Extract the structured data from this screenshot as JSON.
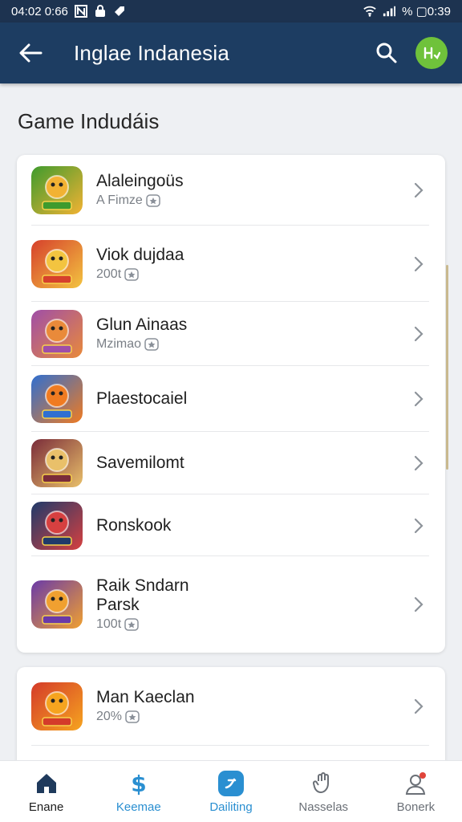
{
  "status_bar": {
    "time": "04:02 0:66",
    "battery_text": "% ▢0:39"
  },
  "app_bar": {
    "title": "Inglae Indanesia"
  },
  "section": {
    "title": "Game Indudáis"
  },
  "apps": [
    {
      "name": "Alaleingoüs",
      "sub": "A Fimze",
      "icon": "jungle-game-icon",
      "colors": [
        "#3e9b2e",
        "#f2b233"
      ]
    },
    {
      "name": "Viok dujdaa",
      "sub": "200t",
      "icon": "warrior-game-icon",
      "colors": [
        "#d6402c",
        "#f3c440"
      ]
    },
    {
      "name": "Glun Ainaas",
      "sub": "Mzimao",
      "icon": "viking-game-icon",
      "colors": [
        "#9f4ea8",
        "#e98a3a"
      ]
    },
    {
      "name": "Plaestocaiel",
      "sub": "",
      "icon": "pumpkin-game-icon",
      "colors": [
        "#2f6fd1",
        "#f07b21"
      ]
    },
    {
      "name": "Savemilomt",
      "sub": "",
      "icon": "monster-game-icon",
      "colors": [
        "#7a2c3a",
        "#e9c06a"
      ]
    },
    {
      "name": "Ronskook",
      "sub": "",
      "icon": "treasure-game-icon",
      "colors": [
        "#1f3a6a",
        "#d64040"
      ]
    },
    {
      "name": "Raik Sndarn\nParsk",
      "sub": "100t",
      "icon": "pirate-game-icon",
      "colors": [
        "#6a3aa8",
        "#f0a030"
      ]
    }
  ],
  "apps_2": [
    {
      "name": "Man Kaeclan",
      "sub": "20%",
      "icon": "smiley-game-icon",
      "colors": [
        "#d43b2a",
        "#f6a41f"
      ]
    }
  ],
  "bottom_nav": [
    {
      "label": "Enane",
      "icon": "home-icon",
      "color": "#1f3a5c",
      "active": true
    },
    {
      "label": "Keemae",
      "icon": "dollar-icon",
      "color": "#2a8fd1",
      "active": false
    },
    {
      "label": "Dailiting",
      "icon": "games-icon",
      "color": "#2a8fd1",
      "active": false
    },
    {
      "label": "Nasselas",
      "icon": "hand-icon",
      "color": "#6b7077",
      "active": false
    },
    {
      "label": "Bonerk",
      "icon": "profile-icon",
      "color": "#6b7077",
      "active": false
    }
  ],
  "colors": {
    "app_bar": "#1d3d62",
    "status_bar": "#1d3350",
    "accent_green": "#6fc23b"
  }
}
